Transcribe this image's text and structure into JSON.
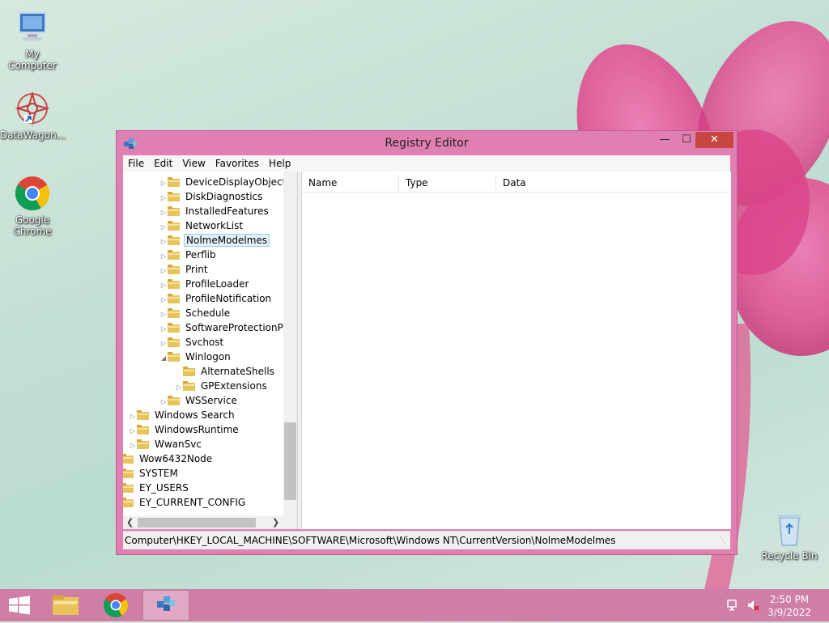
{
  "desktop": {
    "icons": [
      {
        "label": "My Computer"
      },
      {
        "label": "DataWagon..."
      },
      {
        "label": "Google Chrome"
      },
      {
        "label": "Recycle Bin"
      }
    ]
  },
  "window": {
    "title": "Registry Editor",
    "controls": {
      "minimize": "—",
      "maximize": "☐",
      "close": "✕"
    },
    "menu": [
      "File",
      "Edit",
      "View",
      "Favorites",
      "Help"
    ],
    "tree": [
      {
        "label": "DeviceDisplayObjects",
        "expander": "▷",
        "selected": false
      },
      {
        "label": "DiskDiagnostics",
        "expander": "▷",
        "selected": false
      },
      {
        "label": "InstalledFeatures",
        "expander": "▷",
        "selected": false
      },
      {
        "label": "NetworkList",
        "expander": "▷",
        "selected": false
      },
      {
        "label": "NolmeModelmes",
        "expander": "▷",
        "selected": true
      },
      {
        "label": "Perflib",
        "expander": "▷",
        "selected": false
      },
      {
        "label": "Print",
        "expander": "▷",
        "selected": false
      },
      {
        "label": "ProfileLoader",
        "expander": "▷",
        "selected": false
      },
      {
        "label": "ProfileNotification",
        "expander": "▷",
        "selected": false
      },
      {
        "label": "Schedule",
        "expander": "▷",
        "selected": false
      },
      {
        "label": "SoftwareProtectionPla",
        "expander": "▷",
        "selected": false
      },
      {
        "label": "Svchost",
        "expander": "▷",
        "selected": false
      },
      {
        "label": "Winlogon",
        "expander": "◢",
        "selected": false
      },
      {
        "label": "AlternateShells",
        "expander": "",
        "selected": false
      },
      {
        "label": "GPExtensions",
        "expander": "▷",
        "selected": false
      },
      {
        "label": "WSService",
        "expander": "▷",
        "selected": false
      },
      {
        "label": "Windows Search",
        "expander": "▷",
        "selected": false
      },
      {
        "label": "WindowsRuntime",
        "expander": "▷",
        "selected": false
      },
      {
        "label": "WwanSvc",
        "expander": "▷",
        "selected": false
      },
      {
        "label": "Wow6432Node",
        "expander": "",
        "selected": false
      },
      {
        "label": "SYSTEM",
        "expander": "",
        "selected": false
      },
      {
        "label": "EY_USERS",
        "expander": "",
        "selected": false
      },
      {
        "label": "EY_CURRENT_CONFIG",
        "expander": "",
        "selected": false
      }
    ],
    "columns": [
      "Name",
      "Type",
      "Data"
    ],
    "status_path": "Computer\\HKEY_LOCAL_MACHINE\\SOFTWARE\\Microsoft\\Windows NT\\CurrentVersion\\NolmeModelmes"
  },
  "taskbar": {
    "clock_time": "2:50 PM",
    "clock_date": "3/9/2022",
    "accent": "#cf7fa6"
  }
}
